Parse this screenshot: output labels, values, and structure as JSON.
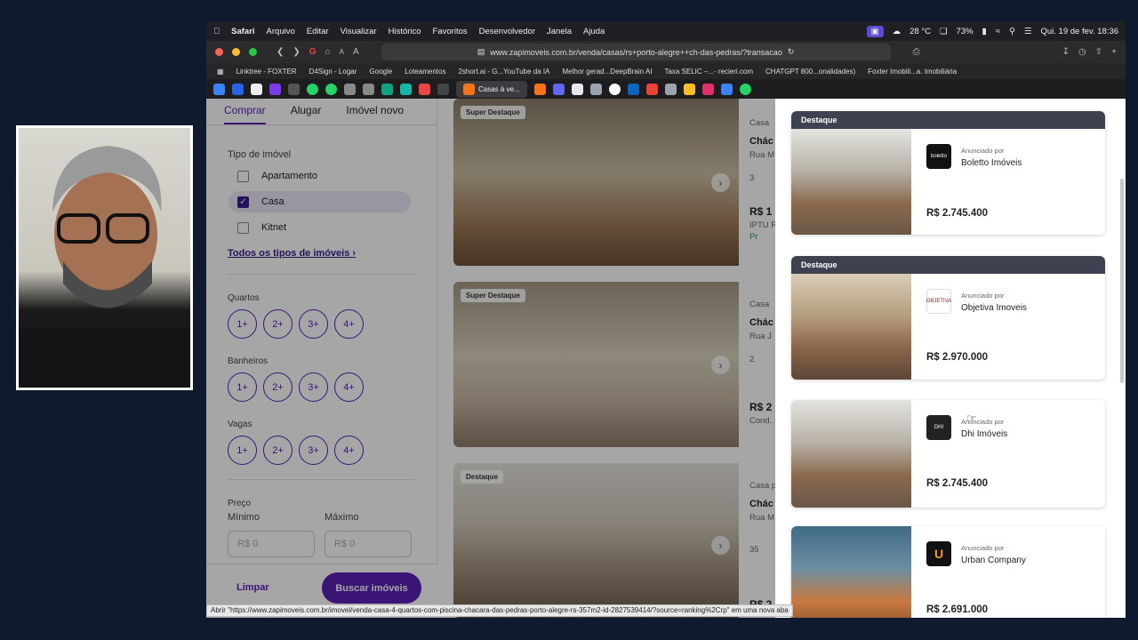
{
  "menubar": {
    "app": "Safari",
    "items": [
      "Arquivo",
      "Editar",
      "Visualizar",
      "Histórico",
      "Favoritos",
      "Desenvolvedor",
      "Janela",
      "Ajuda"
    ],
    "weather": "28 °C",
    "battery": "73%",
    "datetime": "Qui. 19 de fev. 18:36"
  },
  "browser": {
    "url": "www.zapimoveis.com.br/venda/casas/rs+porto-alegre++ch-das-pedras/?transacao",
    "reader_small": "A",
    "reader_large": "A"
  },
  "bookmarks": [
    "Linktree - FOXTER",
    "D4Sign - Logar",
    "Google",
    "Loteamentos",
    "2short.ai - G...YouTube da IA",
    "Melhor gerad...DeepBrain AI",
    "Taxa SELIC –...- recieri.com",
    "CHATGPT 800...onalidades)",
    "Foxter Imobili...a. Imobiliária"
  ],
  "tabs": {
    "active_label": "Casas à ve..."
  },
  "filters": {
    "tabs": [
      "Comprar",
      "Alugar",
      "Imóvel novo"
    ],
    "tipo_title": "Tipo de imóvel",
    "tipos": [
      "Apartamento",
      "Casa",
      "Kitnet"
    ],
    "todos_link": "Todos os tipos de imóveis",
    "quartos_title": "Quartos",
    "banheiros_title": "Banheiros",
    "vagas_title": "Vagas",
    "pills": [
      "1+",
      "2+",
      "3+",
      "4+"
    ],
    "preco_title": "Preço",
    "min_label": "Mínimo",
    "max_label": "Máximo",
    "min_placeholder": "R$ 0",
    "max_placeholder": "R$ 0",
    "limpar": "Limpar",
    "buscar": "Buscar imóveis"
  },
  "results": [
    {
      "badge": "Super Destaque",
      "l1": "Casa",
      "l2": "Chác",
      "l3": "Rua M",
      "l4": "3",
      "l5": "R$ 1",
      "l6": "IPTU R",
      "l7": "Pr"
    },
    {
      "badge": "Super Destaque",
      "l1": "Casa",
      "l2": "Chác",
      "l3": "Rua J",
      "l4": "2",
      "l5": "R$ 2",
      "l6": "Cond. I",
      "l7": ""
    },
    {
      "badge": "Destaque",
      "l1": "Casa p",
      "l2": "Chác",
      "l3": "Rua M",
      "l4": "35",
      "l5": "R$ 2",
      "l6": "",
      "l7": ""
    }
  ],
  "ads": [
    {
      "head": "Destaque",
      "annby": "Anunciado por",
      "agent": "Boletto Imóveis",
      "logo": "boletto",
      "price": "R$ 2.745.400"
    },
    {
      "head": "Destaque",
      "annby": "Anunciado por",
      "agent": "Objetiva Imoveis",
      "logo": "OBJETIVA",
      "price": "R$ 2.970.000"
    },
    {
      "head": "",
      "annby": "Anunciado por",
      "agent": "Dhi Imóveis",
      "logo": "DHI",
      "price": "R$ 2.745.400"
    },
    {
      "head": "",
      "annby": "Anunciado por",
      "agent": "Urban Company",
      "logo": "U",
      "price": "R$ 2.691.000"
    }
  ],
  "statusbar": "Abrir \"https://www.zapimoveis.com.br/imovel/venda-casa-4-quartos-com-piscina-chacara-das-pedras-porto-alegre-rs-357m2-id-2827539414/?source=ranking%2Crp\" em uma nova aba",
  "colors": {
    "brand": "#5b21b6",
    "ad_header": "#3e4250"
  }
}
